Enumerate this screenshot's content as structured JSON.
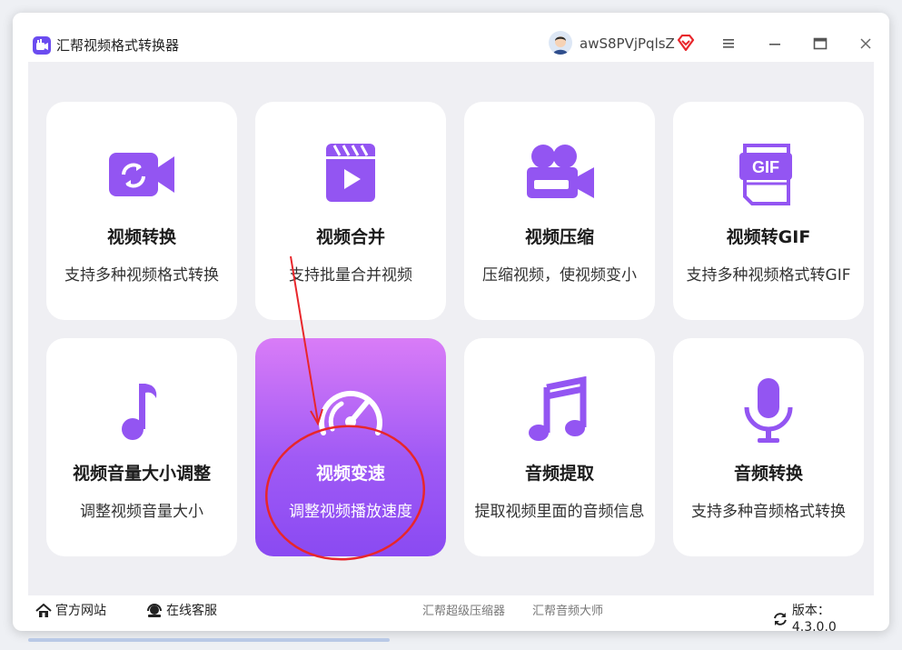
{
  "window": {
    "title": "汇帮视频格式转换器",
    "username": "awS8PVjPqlsZ"
  },
  "cards": [
    {
      "title": "视频转换",
      "desc": "支持多种视频格式转换",
      "icon": "video-convert-icon"
    },
    {
      "title": "视频合并",
      "desc": "支持批量合并视频",
      "icon": "clapperboard-play-icon"
    },
    {
      "title": "视频压缩",
      "desc": "压缩视频，使视频变小",
      "icon": "video-camera-icon"
    },
    {
      "title": "视频转GIF",
      "desc": "支持多种视频格式转GIF",
      "icon": "gif-file-icon",
      "icon_text": "GIF"
    },
    {
      "title": "视频音量大小调整",
      "desc": "调整视频音量大小",
      "icon": "music-note-icon"
    },
    {
      "title": "视频变速",
      "desc": "调整视频播放速度",
      "icon": "speedometer-icon",
      "active": true
    },
    {
      "title": "音频提取",
      "desc": "提取视频里面的音频信息",
      "icon": "music-notes-icon"
    },
    {
      "title": "音频转换",
      "desc": "支持多种音频格式转换",
      "icon": "microphone-icon"
    }
  ],
  "footer": {
    "website": "官方网站",
    "support": "在线客服",
    "link1": "汇帮超级压缩器",
    "link2": "汇帮音频大师",
    "version_label": "版本：4.3.0.0"
  },
  "colors": {
    "accent": "#8b4cf3",
    "active_gradient_top": "#d97cf7",
    "active_gradient_bottom": "#8a4af2",
    "annotation_red": "#e8262b"
  }
}
